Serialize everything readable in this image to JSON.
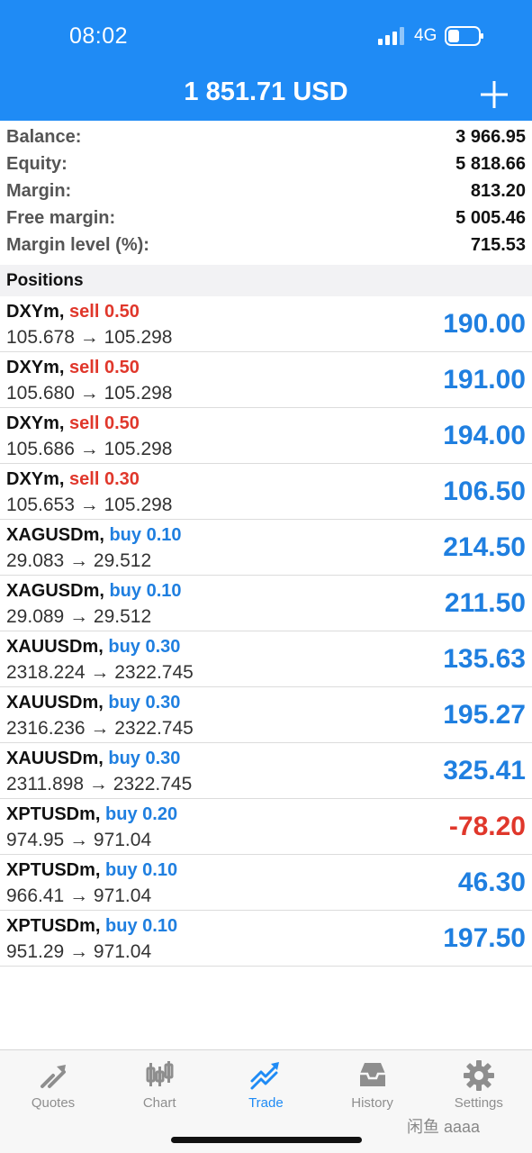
{
  "status_bar": {
    "time": "08:02",
    "network": "4G"
  },
  "header": {
    "title": "1 851.71 USD"
  },
  "summary": [
    {
      "label": "Balance:",
      "value": "3 966.95"
    },
    {
      "label": "Equity:",
      "value": "5 818.66"
    },
    {
      "label": "Margin:",
      "value": "813.20"
    },
    {
      "label": "Free margin:",
      "value": "5 005.46"
    },
    {
      "label": "Margin level (%):",
      "value": "715.53"
    }
  ],
  "positions_title": "Positions",
  "positions": [
    {
      "symbol": "DXYm,",
      "side": "sell 0.50",
      "prices": "105.678 → 105.298",
      "profit": "190.00"
    },
    {
      "symbol": "DXYm,",
      "side": "sell 0.50",
      "prices": "105.680 → 105.298",
      "profit": "191.00"
    },
    {
      "symbol": "DXYm,",
      "side": "sell 0.50",
      "prices": "105.686 → 105.298",
      "profit": "194.00"
    },
    {
      "symbol": "DXYm,",
      "side": "sell 0.30",
      "prices": "105.653 → 105.298",
      "profit": "106.50"
    },
    {
      "symbol": "XAGUSDm,",
      "side": "buy 0.10",
      "prices": "29.083 → 29.512",
      "profit": "214.50"
    },
    {
      "symbol": "XAGUSDm,",
      "side": "buy 0.10",
      "prices": "29.089 → 29.512",
      "profit": "211.50"
    },
    {
      "symbol": "XAUUSDm,",
      "side": "buy 0.30",
      "prices": "2318.224 → 2322.745",
      "profit": "135.63"
    },
    {
      "symbol": "XAUUSDm,",
      "side": "buy 0.30",
      "prices": "2316.236 → 2322.745",
      "profit": "195.27"
    },
    {
      "symbol": "XAUUSDm,",
      "side": "buy 0.30",
      "prices": "2311.898 → 2322.745",
      "profit": "325.41"
    },
    {
      "symbol": "XPTUSDm,",
      "side": "buy 0.20",
      "prices": "974.95 → 971.04",
      "profit": "-78.20"
    },
    {
      "symbol": "XPTUSDm,",
      "side": "buy 0.10",
      "prices": "966.41 → 971.04",
      "profit": "46.30"
    },
    {
      "symbol": "XPTUSDm,",
      "side": "buy 0.10",
      "prices": "951.29 → 971.04",
      "profit": "197.50"
    }
  ],
  "tabs": [
    {
      "label": "Quotes",
      "icon": "quotes-icon",
      "active": false
    },
    {
      "label": "Chart",
      "icon": "chart-icon",
      "active": false
    },
    {
      "label": "Trade",
      "icon": "trade-icon",
      "active": true
    },
    {
      "label": "History",
      "icon": "history-icon",
      "active": false
    },
    {
      "label": "Settings",
      "icon": "gear-icon",
      "active": false
    }
  ],
  "watermark": "闲鱼 aaaa",
  "colors": {
    "accent": "#1f8bf5",
    "sell": "#e0372b",
    "buy": "#1f7fe0",
    "negative": "#e0372b"
  }
}
